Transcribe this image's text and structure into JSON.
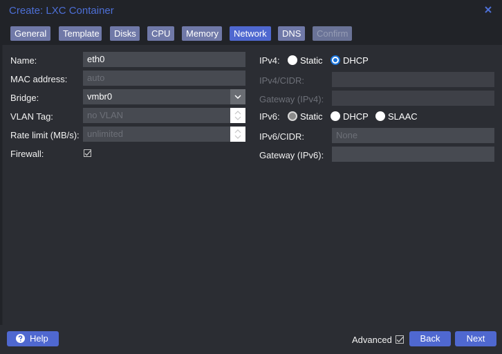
{
  "window": {
    "title": "Create: LXC Container"
  },
  "tabs": [
    {
      "label": "General",
      "state": "normal"
    },
    {
      "label": "Template",
      "state": "normal"
    },
    {
      "label": "Disks",
      "state": "normal"
    },
    {
      "label": "CPU",
      "state": "normal"
    },
    {
      "label": "Memory",
      "state": "normal"
    },
    {
      "label": "Network",
      "state": "active"
    },
    {
      "label": "DNS",
      "state": "normal"
    },
    {
      "label": "Confirm",
      "state": "disabled"
    }
  ],
  "left": {
    "name": {
      "label": "Name:",
      "value": "eth0"
    },
    "mac": {
      "label": "MAC address:",
      "placeholder": "auto"
    },
    "bridge": {
      "label": "Bridge:",
      "value": "vmbr0"
    },
    "vlan": {
      "label": "VLAN Tag:",
      "placeholder": "no VLAN"
    },
    "rate": {
      "label": "Rate limit (MB/s):",
      "placeholder": "unlimited"
    },
    "firewall": {
      "label": "Firewall:",
      "checked": true
    }
  },
  "right": {
    "ipv4": {
      "label": "IPv4:",
      "options": [
        "Static",
        "DHCP"
      ],
      "selected": "DHCP"
    },
    "ipv4_cidr": {
      "label": "IPv4/CIDR:",
      "value": ""
    },
    "gateway_ipv4": {
      "label": "Gateway (IPv4):",
      "value": ""
    },
    "ipv6": {
      "label": "IPv6:",
      "options": [
        "Static",
        "DHCP",
        "SLAAC"
      ],
      "selected": "Static"
    },
    "ipv6_cidr": {
      "label": "IPv6/CIDR:",
      "placeholder": "None"
    },
    "gateway_ipv6": {
      "label": "Gateway (IPv6):",
      "value": ""
    }
  },
  "footer": {
    "help_label": "Help",
    "advanced_label": "Advanced",
    "advanced_checked": true,
    "back_label": "Back",
    "next_label": "Next"
  },
  "colors": {
    "accent": "#4f68d0",
    "title": "#4d6fd6",
    "tab": "#7079a8",
    "background": "#2b2d33"
  }
}
